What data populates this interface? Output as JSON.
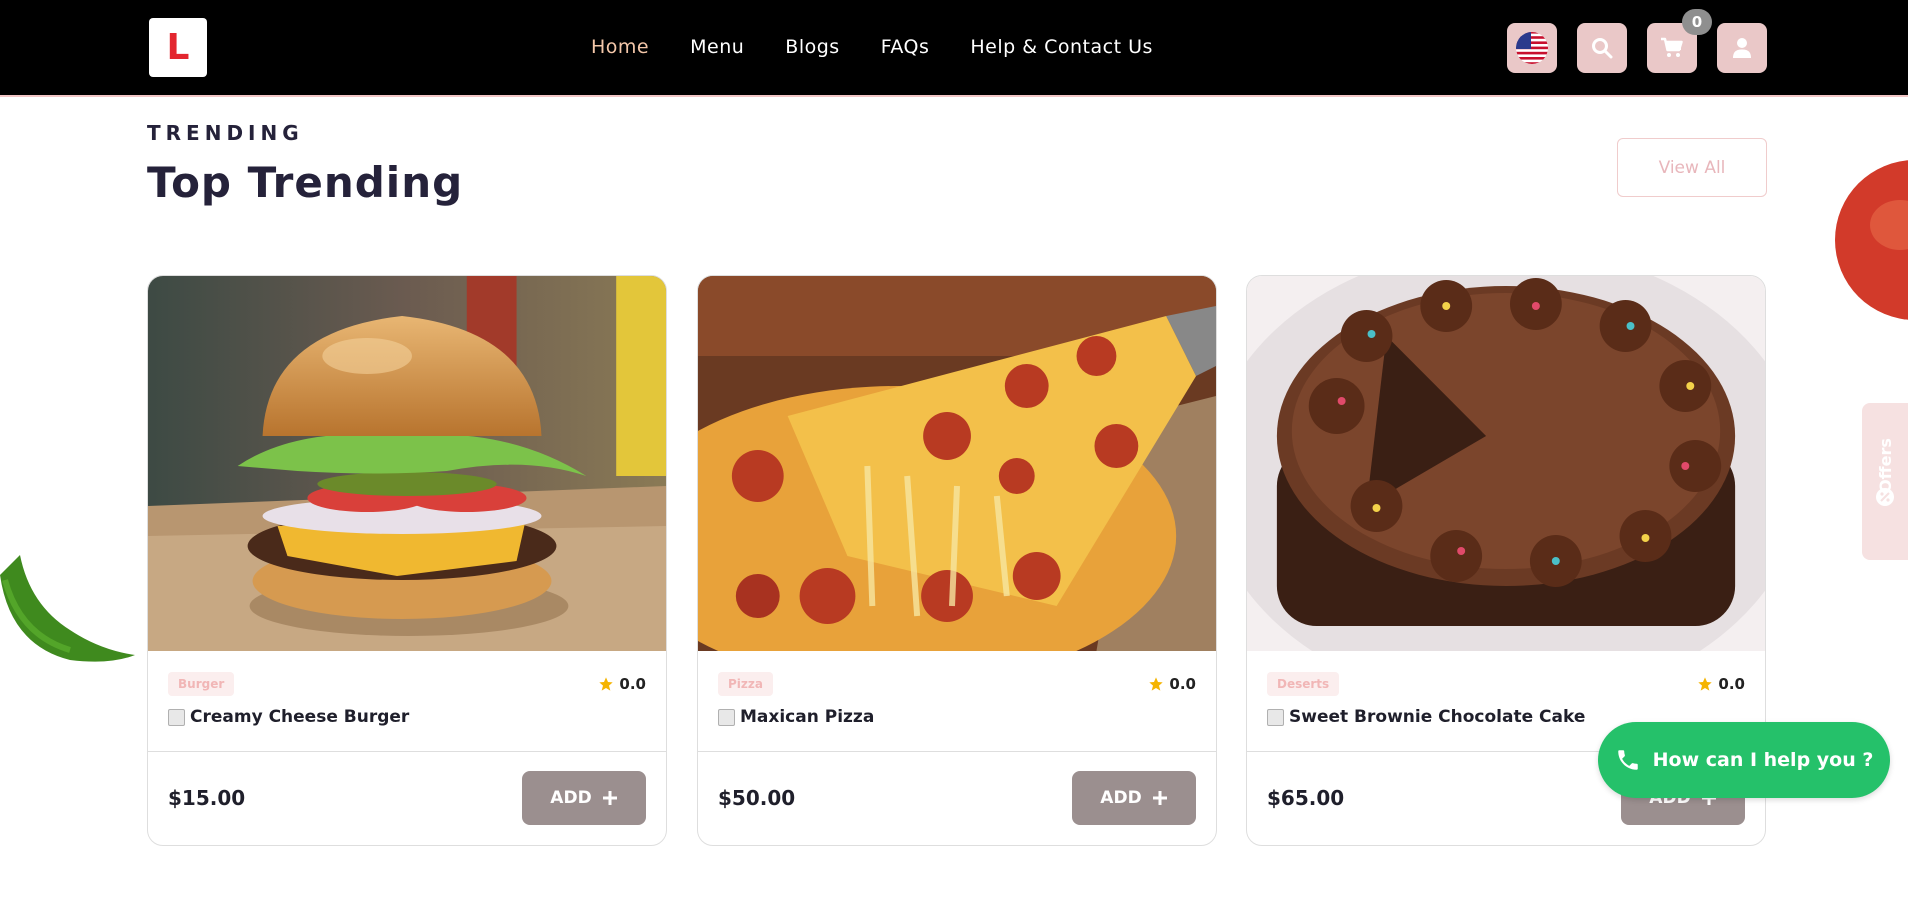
{
  "header": {
    "logo_letter": "L",
    "nav": [
      {
        "label": "Home",
        "active": true
      },
      {
        "label": "Menu",
        "active": false
      },
      {
        "label": "Blogs",
        "active": false
      },
      {
        "label": "FAQs",
        "active": false
      },
      {
        "label": "Help & Contact Us",
        "active": false
      }
    ],
    "cart_count": "0",
    "icons": [
      "us-flag-icon",
      "search-icon",
      "cart-icon",
      "user-icon"
    ]
  },
  "section": {
    "eyebrow": "TRENDING",
    "title": "Top Trending",
    "view_all": "View All"
  },
  "products": [
    {
      "category": "Burger",
      "rating": "0.0",
      "name": "Creamy Cheese Burger",
      "price": "$15.00",
      "add_label": "ADD"
    },
    {
      "category": "Pizza",
      "rating": "0.0",
      "name": "Maxican Pizza",
      "price": "$50.00",
      "add_label": "ADD"
    },
    {
      "category": "Deserts",
      "rating": "0.0",
      "name": "Sweet Brownie Chocolate Cake",
      "price": "$65.00",
      "add_label": "ADD"
    }
  ],
  "offers_label": "Offers",
  "help_label": "How can I help you ?",
  "colors": {
    "header_bg": "#000000",
    "nav_active": "#f4c7a9",
    "icon_button_bg": "#eac8c8",
    "add_button_bg": "#9b8f8f",
    "help_bg": "#25c16a",
    "title_color": "#25223a"
  }
}
